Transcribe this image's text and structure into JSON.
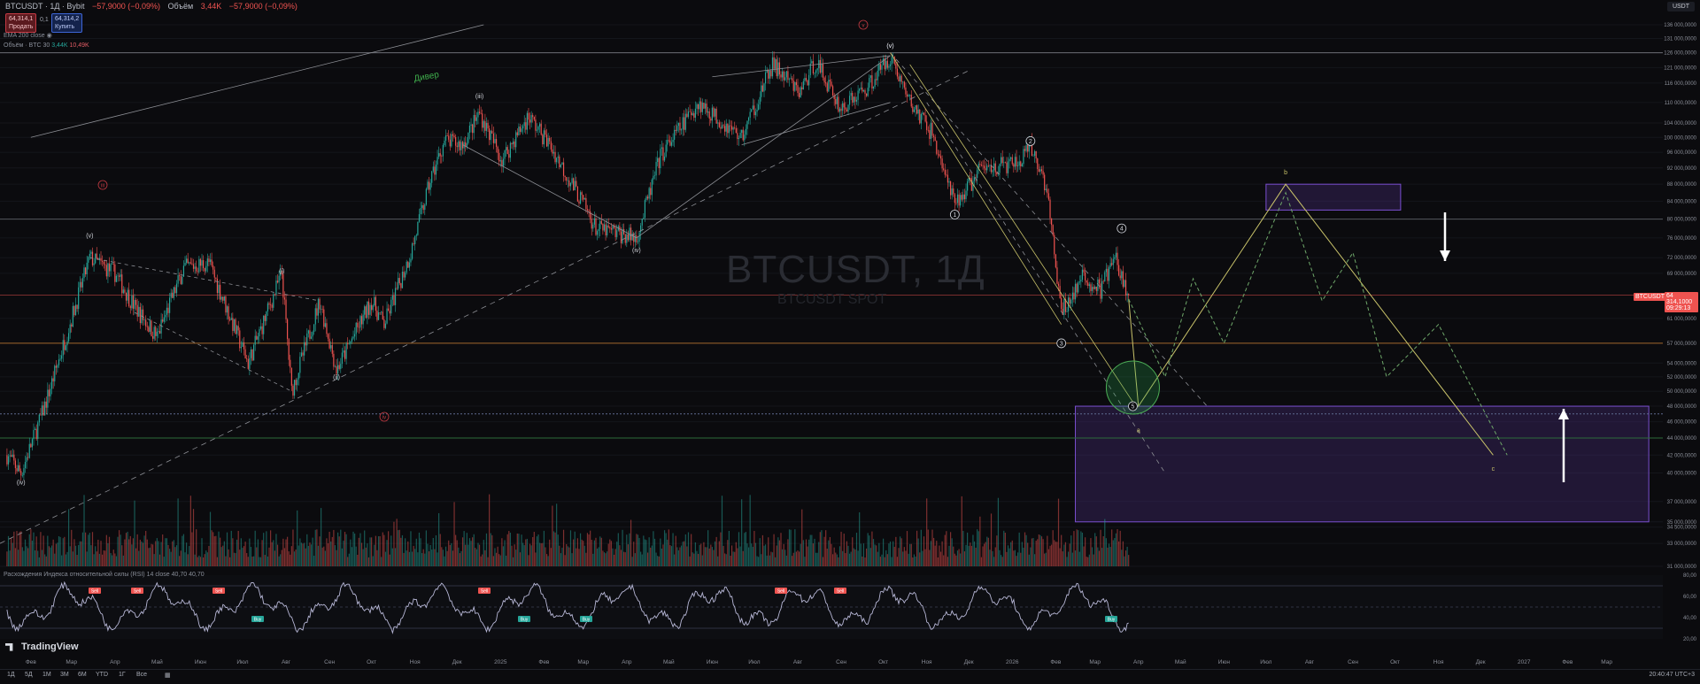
{
  "header": {
    "symbol": "BTCUSDT · 1Д · Bybit",
    "change": "−57,9000 (−0,09%)",
    "volume_label": "Объём",
    "volume_value": "3,44K",
    "ohlc_change": "−57,9000 (−0,09%)",
    "sell_price": "64,314,1",
    "sell_label": "Продать",
    "spread": "0,1",
    "buy_price": "64,314,2",
    "buy_label": "Купить",
    "ema_label": "EMA 200 close",
    "vol_ind_label": "Объём · BTC 30",
    "vol_ind_val1": "3,44K",
    "vol_ind_val2": "10,49K",
    "rsi_label": "Расхождения Индекса относительной силы (RSI) 14 close",
    "rsi_val1": "40,70",
    "rsi_val2": "40,70"
  },
  "currency_selector": "USDT",
  "watermark": {
    "title": "BTCUSDT, 1Д",
    "subtitle": "BTCUSDT SPOT"
  },
  "price_axis": {
    "labels": [
      "136 000,0000",
      "131 000,0000",
      "126 000,0000",
      "121 000,0000",
      "116 000,0000",
      "110 000,0000",
      "104 000,0000",
      "100 000,0000",
      "96 000,0000",
      "92 000,0000",
      "88 000,0000",
      "84 000,0000",
      "80 000,0000",
      "76 000,0000",
      "72 000,0000",
      "69 000,0000",
      "65 000,0000",
      "61 000,0000",
      "57 000,0000",
      "54 000,0000",
      "52 000,0000",
      "50 000,0000",
      "48 000,0000",
      "46 000,0000",
      "44 000,0000",
      "42 000,0000",
      "40 000,0000",
      "37 000,0000",
      "35 000,0000",
      "34 500,0000",
      "33 000,0000",
      "31 000,0000"
    ],
    "current_price_tag": "BTCUSDT",
    "current_price": "64 314,1000",
    "countdown": "09:29:13"
  },
  "rsi_axis": {
    "labels": [
      "80,00",
      "60,00",
      "40,00",
      "20,00"
    ]
  },
  "time_axis": {
    "labels": [
      "Фев",
      "Мар",
      "Апр",
      "Май",
      "Июн",
      "Июл",
      "Авг",
      "Сен",
      "Окт",
      "Ноя",
      "Дек",
      "2025",
      "Фев",
      "Мар",
      "Апр",
      "Май",
      "Июн",
      "Июл",
      "Авг",
      "Сен",
      "Окт",
      "Ноя",
      "Дек",
      "2026",
      "Фев",
      "Мар",
      "Апр",
      "Май",
      "Июн",
      "Июл",
      "Авг",
      "Сен",
      "Окт",
      "Ноя",
      "Дек",
      "2027",
      "Фев",
      "Мар"
    ]
  },
  "annotations": {
    "diver": "Дивер",
    "wave_labels": [
      "(iv)",
      "(v)",
      "(i)",
      "(ii)",
      "(iii)",
      "(iv)",
      "(v)",
      "(v)",
      "1",
      "2",
      "3",
      "4",
      "5",
      "a",
      "b",
      "c"
    ],
    "red_circles": [
      "iii",
      "iv",
      "v"
    ],
    "rsi_sell": [
      "Sell",
      "Sell",
      "Sell",
      "Sell",
      "Sell",
      "Sell"
    ],
    "rsi_buy": [
      "Buy",
      "Buy",
      "Buy",
      "Buy"
    ]
  },
  "bottom_bar": {
    "timeframes": [
      "1Д",
      "5Д",
      "1М",
      "3М",
      "6М",
      "YTD",
      "1Г",
      "Все"
    ],
    "clock": "20:40:47 UTC+3"
  },
  "brand": "TradingView",
  "colors": {
    "bull": "#26a69a",
    "bear": "#ef5350",
    "zone": "#4b2f7f",
    "projection_solid": "#c9c36a",
    "projection_dashed": "#6fa86a",
    "rsi": "#b7b7d6"
  },
  "chart_data": {
    "type": "candlestick",
    "timeframe": "1Д",
    "price_series_close": [
      {
        "x": "2024-01-15",
        "y": 42000
      },
      {
        "x": "2024-01-25",
        "y": 40000
      },
      {
        "x": "2024-02-10",
        "y": 47500
      },
      {
        "x": "2024-03-01",
        "y": 61000
      },
      {
        "x": "2024-03-14",
        "y": 72000
      },
      {
        "x": "2024-04-01",
        "y": 69000
      },
      {
        "x": "2024-04-15",
        "y": 63000
      },
      {
        "x": "2024-05-01",
        "y": 58000
      },
      {
        "x": "2024-05-20",
        "y": 70000
      },
      {
        "x": "2024-06-07",
        "y": 71000
      },
      {
        "x": "2024-07-05",
        "y": 54000
      },
      {
        "x": "2024-07-29",
        "y": 69000
      },
      {
        "x": "2024-08-05",
        "y": 50000
      },
      {
        "x": "2024-08-25",
        "y": 64000
      },
      {
        "x": "2024-09-06",
        "y": 53000
      },
      {
        "x": "2024-10-01",
        "y": 64000
      },
      {
        "x": "2024-10-10",
        "y": 60000
      },
      {
        "x": "2024-10-29",
        "y": 73000
      },
      {
        "x": "2024-11-12",
        "y": 89000
      },
      {
        "x": "2024-11-22",
        "y": 99000
      },
      {
        "x": "2024-12-05",
        "y": 98000
      },
      {
        "x": "2024-12-17",
        "y": 107000
      },
      {
        "x": "2025-01-02",
        "y": 94000
      },
      {
        "x": "2025-01-21",
        "y": 106000
      },
      {
        "x": "2025-02-05",
        "y": 98000
      },
      {
        "x": "2025-02-28",
        "y": 84000
      },
      {
        "x": "2025-03-10",
        "y": 78000
      },
      {
        "x": "2025-04-08",
        "y": 76000
      },
      {
        "x": "2025-04-25",
        "y": 95000
      },
      {
        "x": "2025-05-22",
        "y": 110000
      },
      {
        "x": "2025-06-22",
        "y": 100000
      },
      {
        "x": "2025-07-14",
        "y": 122000
      },
      {
        "x": "2025-08-02",
        "y": 113000
      },
      {
        "x": "2025-08-14",
        "y": 123000
      },
      {
        "x": "2025-09-01",
        "y": 108000
      },
      {
        "x": "2025-09-20",
        "y": 115000
      },
      {
        "x": "2025-10-06",
        "y": 125000
      },
      {
        "x": "2025-10-20",
        "y": 110000
      },
      {
        "x": "2025-11-05",
        "y": 101000
      },
      {
        "x": "2025-11-21",
        "y": 83000
      },
      {
        "x": "2025-12-10",
        "y": 92000
      },
      {
        "x": "2026-01-05",
        "y": 93000
      },
      {
        "x": "2026-01-14",
        "y": 97000
      },
      {
        "x": "2026-01-25",
        "y": 88000
      },
      {
        "x": "2026-02-05",
        "y": 62000
      },
      {
        "x": "2026-02-20",
        "y": 68000
      },
      {
        "x": "2026-03-05",
        "y": 66000
      },
      {
        "x": "2026-03-15",
        "y": 72000
      },
      {
        "x": "2026-03-25",
        "y": 64314
      }
    ],
    "projection": [
      {
        "x": "2026-04-01",
        "y": 48000,
        "label": "a"
      },
      {
        "x": "2026-07-15",
        "y": 88000,
        "label": "b"
      },
      {
        "x": "2026-12-10",
        "y": 42000,
        "label": "c"
      }
    ],
    "zones": [
      {
        "from": "2026-07-01",
        "to": "2026-10-05",
        "low": 82000,
        "high": 88000
      },
      {
        "from": "2026-02-15",
        "to": "2027-03-31",
        "low": 35000,
        "high": 48000
      }
    ],
    "horizontal_levels": [
      126000,
      80000,
      65000,
      57000,
      47000,
      44000
    ],
    "y_scale": "log",
    "ylim": [
      31000,
      136000
    ],
    "rsi": {
      "label": "RSI 14",
      "ylim": [
        20,
        80
      ],
      "levels": [
        70,
        50,
        30
      ]
    }
  }
}
